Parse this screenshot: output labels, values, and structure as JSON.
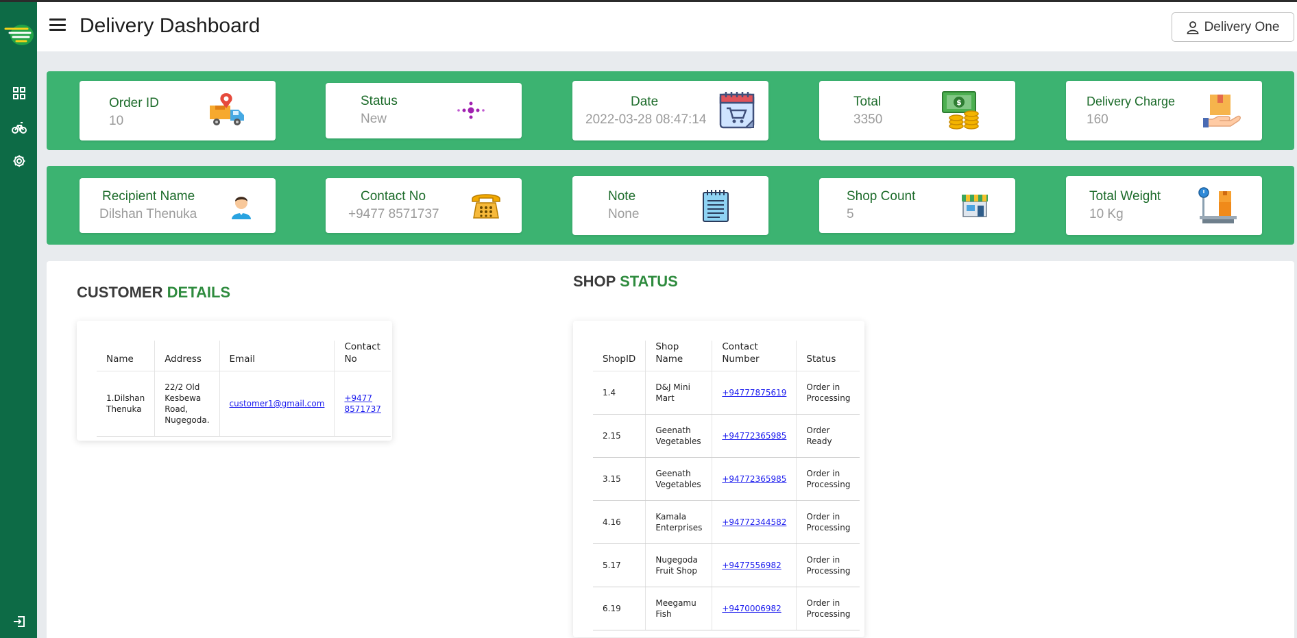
{
  "app": {
    "title": "Delivery Dashboard"
  },
  "user": {
    "name": "Delivery One"
  },
  "sidebar": {
    "items": [
      {
        "icon": "dashboard-grid-icon"
      },
      {
        "icon": "bicycle-icon"
      },
      {
        "icon": "settings-gear-icon"
      }
    ],
    "logout_icon": "logout-icon"
  },
  "order_stats": [
    {
      "label": "Order ID",
      "value": "10",
      "icon": "delivery-truck-icon"
    },
    {
      "label": "Status",
      "value": "New",
      "icon": "status-dots-icon"
    },
    {
      "label": "Date",
      "value": "2022-03-28 08:47:14",
      "icon": "calendar-cart-icon"
    },
    {
      "label": "Total",
      "value": "3350",
      "icon": "money-coins-icon"
    },
    {
      "label": "Delivery Charge",
      "value": "160",
      "icon": "package-hand-icon"
    }
  ],
  "recipient_stats": [
    {
      "label": "Recipient Name",
      "value": "Dilshan Thenuka",
      "icon": "person-avatar-icon"
    },
    {
      "label": "Contact No",
      "value": "+9477 8571737",
      "icon": "telephone-icon"
    },
    {
      "label": "Note",
      "value": "None",
      "icon": "notepad-icon"
    },
    {
      "label": "Shop Count",
      "value": "5",
      "icon": "shop-store-icon"
    },
    {
      "label": "Total Weight",
      "value": "10 Kg",
      "icon": "weight-scale-icon"
    }
  ],
  "customer_details": {
    "title_a": "CUSTOMER",
    "title_b": "DETAILS",
    "headers": {
      "name": "Name",
      "address": "Address",
      "email": "Email",
      "contact_1": "Contact",
      "contact_2": "No"
    },
    "row": {
      "name_1": "1.Dilshan",
      "name_2": "Thenuka",
      "address_1": "22/2 Old",
      "address_2": "Kesbewa",
      "address_3": "Road,",
      "address_4": "Nugegoda.",
      "email": "customer1@gmail.com",
      "contact_1": "+9477",
      "contact_2": "8571737"
    }
  },
  "shop_status": {
    "title_a": "SHOP",
    "title_b": "STATUS",
    "headers": {
      "id": "ShopID",
      "name_1": "Shop",
      "name_2": "Name",
      "contact_1": "Contact",
      "contact_2": "Number",
      "status": "Status"
    },
    "rows": [
      {
        "id": "1.4",
        "name_1": "D&J Mini",
        "name_2": "Mart",
        "contact": "+94777875619",
        "status_1": "Order in",
        "status_2": "Processing"
      },
      {
        "id": "2.15",
        "name_1": "Geenath",
        "name_2": "Vegetables",
        "contact": "+94772365985",
        "status_1": "Order",
        "status_2": "Ready"
      },
      {
        "id": "3.15",
        "name_1": "Geenath",
        "name_2": "Vegetables",
        "contact": "+94772365985",
        "status_1": "Order in",
        "status_2": "Processing"
      },
      {
        "id": "4.16",
        "name_1": "Kamala",
        "name_2": "Enterprises",
        "contact": "+94772344582",
        "status_1": "Order in",
        "status_2": "Processing"
      },
      {
        "id": "5.17",
        "name_1": "Nugegoda",
        "name_2": "Fruit Shop",
        "contact": "+9477556982",
        "status_1": "Order in",
        "status_2": "Processing"
      },
      {
        "id": "6.19",
        "name_1": "Meegamu",
        "name_2": "Fish",
        "contact": "+9470006982",
        "status_1": "Order in",
        "status_2": "Processing"
      }
    ]
  },
  "colors": {
    "sidebar": "#0d6b46",
    "band": "#3cb371",
    "label_green": "#1c6b2a",
    "accent_green": "#2e8b3e",
    "link": "#1a1aee"
  }
}
